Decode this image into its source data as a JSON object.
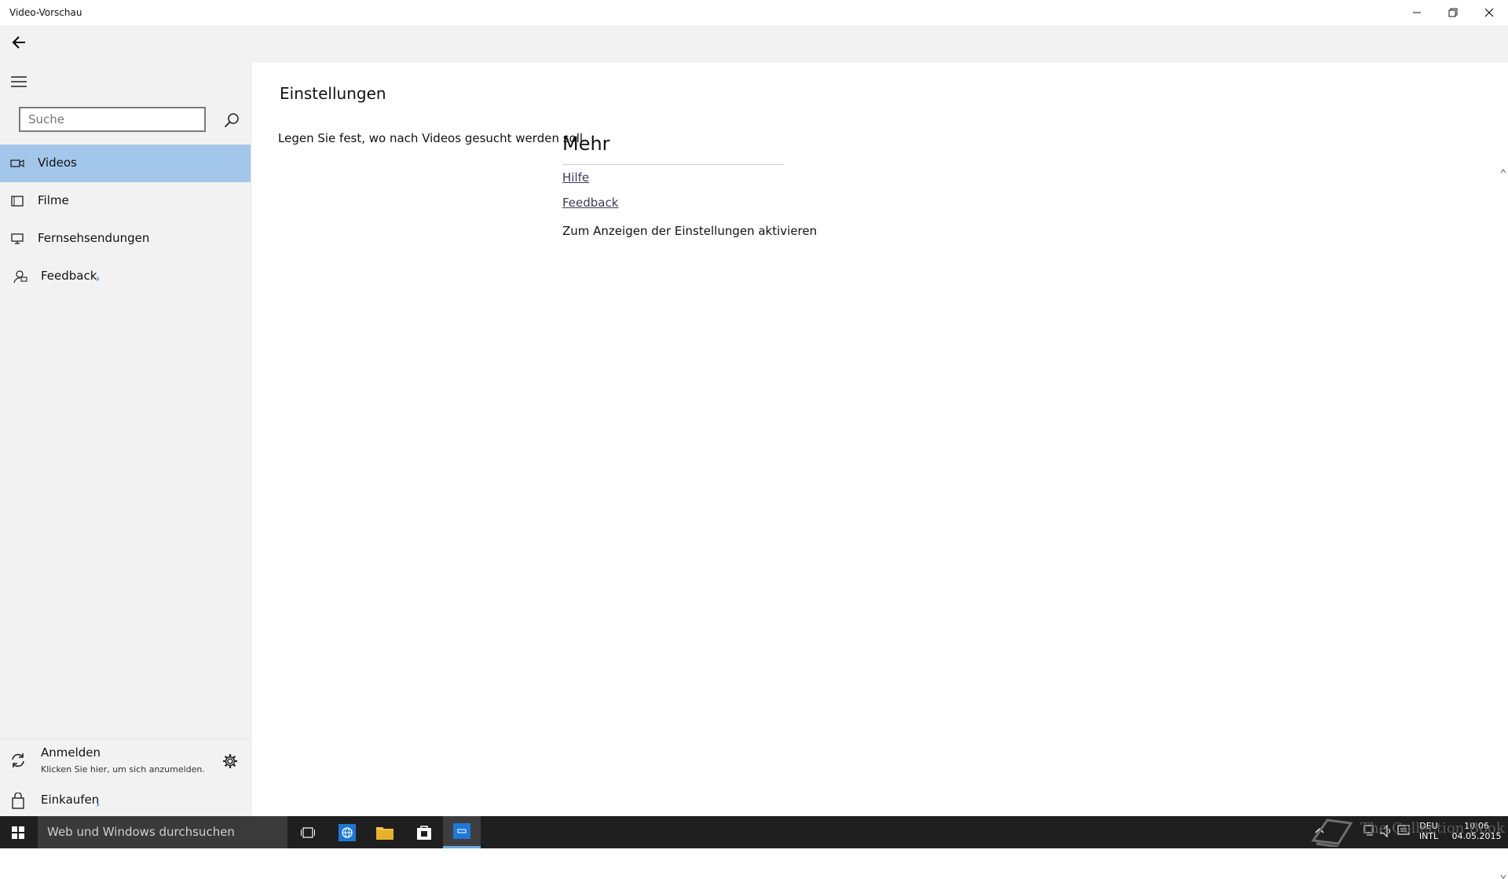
{
  "window": {
    "title": "Video-Vorschau"
  },
  "sidebar": {
    "search_placeholder": "Suche",
    "items": [
      {
        "label": "Videos",
        "icon": "camera-icon",
        "selected": true
      },
      {
        "label": "Filme",
        "icon": "film-icon",
        "selected": false
      },
      {
        "label": "Fernsehsendungen",
        "icon": "tv-icon",
        "selected": false
      },
      {
        "label": "Feedback",
        "icon": "feedback-icon",
        "selected": false,
        "arrow": "›"
      }
    ],
    "account": {
      "name": "Anmelden",
      "hint": "Klicken Sie hier, um sich anzumelden."
    },
    "shop": {
      "label": "Einkaufen",
      "arrow": "›"
    }
  },
  "main": {
    "title": "Einstellungen",
    "scope_text": "Legen Sie fest, wo nach Videos gesucht werden soll",
    "more_heading": "Mehr",
    "links": [
      "Hilfe",
      "Feedback"
    ],
    "activate_text": "Zum Anzeigen der Einstellungen aktivieren"
  },
  "taskbar": {
    "search_placeholder": "Web und Windows durchsuchen",
    "language": "DEU",
    "layout": "INTL",
    "time": "10:06",
    "date": "04.05.2015"
  },
  "watermark": {
    "text": "The Collection Book"
  },
  "colors": {
    "selected_nav": "#a3c7ea",
    "sidebar_bg": "#f2f2f2",
    "taskbar_bg": "#1f1f1f",
    "accent": "#1a6fc4"
  }
}
